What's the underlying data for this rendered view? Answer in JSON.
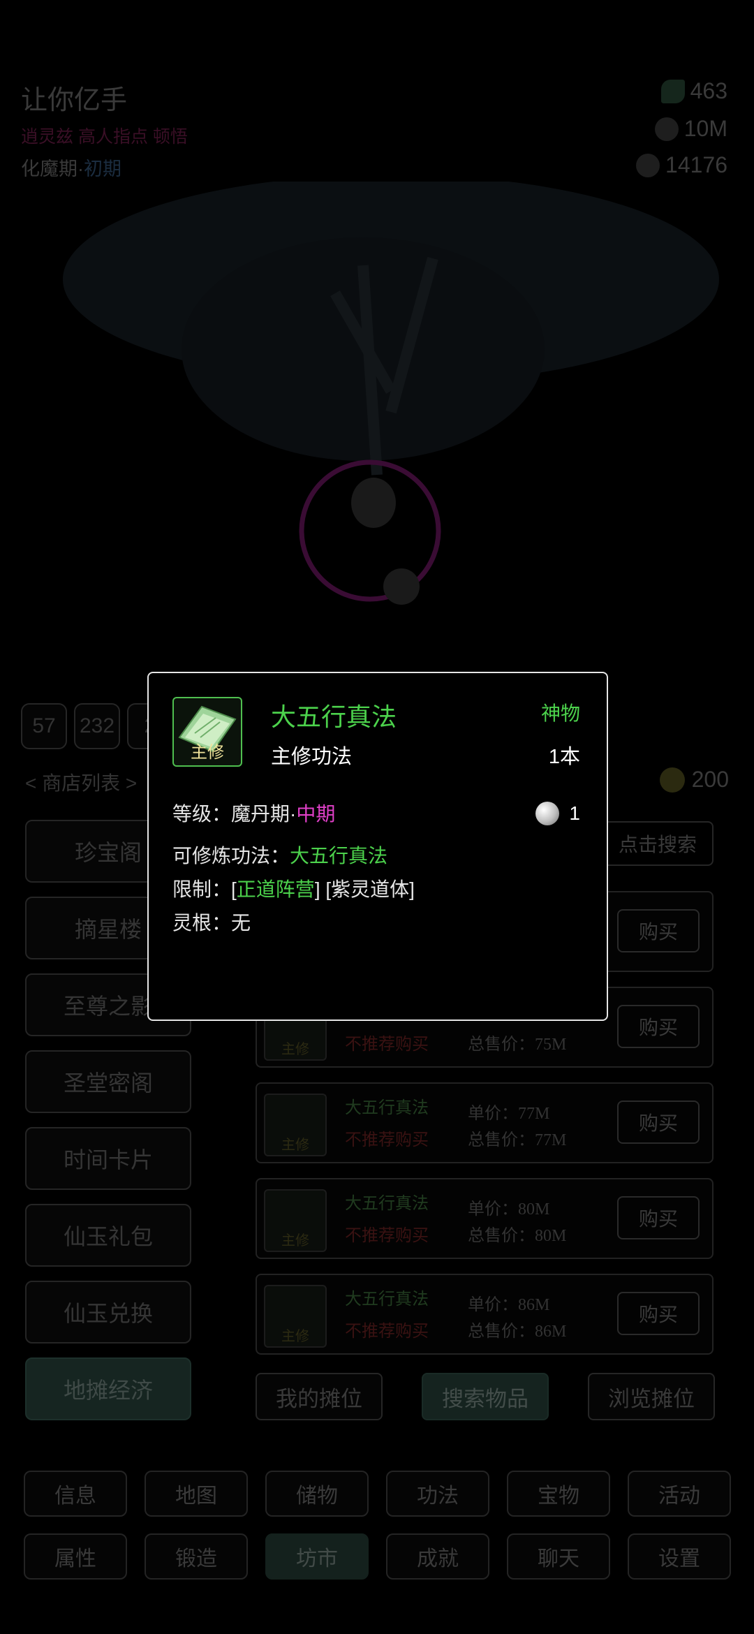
{
  "player": {
    "name": "让你亿手",
    "titles": "逍灵兹 高人指点 顿悟",
    "realm": "化魔期",
    "realm_sep": "·",
    "stage": "初期"
  },
  "resources": [
    {
      "icon": "leaf-icon",
      "value": "463"
    },
    {
      "icon": "silver-coin-icon",
      "value": "10M"
    },
    {
      "icon": "spirit-stone-icon",
      "value": "14176"
    }
  ],
  "badges": [
    "57",
    "232",
    "2"
  ],
  "shop": {
    "list_label": "< 商店列表 >",
    "coin_value": "200",
    "search_click": "点击搜索"
  },
  "side_menu": [
    "珍宝阁",
    "摘星楼",
    "至尊之影",
    "圣堂密阁",
    "时间卡片",
    "仙玉礼包",
    "仙玉兑换",
    "地摊经济"
  ],
  "side_menu_active": 7,
  "listings": [
    {
      "name": "",
      "warn": "",
      "unit": "",
      "total": "",
      "buy": "购买"
    },
    {
      "name": "",
      "warn": "不推荐购买",
      "unit": "",
      "total": "总售价：75M",
      "buy": "购买"
    },
    {
      "name": "大五行真法",
      "warn": "不推荐购买",
      "unit": "单价：77M",
      "total": "总售价：77M",
      "buy": "购买"
    },
    {
      "name": "大五行真法",
      "warn": "不推荐购买",
      "unit": "单价：80M",
      "total": "总售价：80M",
      "buy": "购买"
    },
    {
      "name": "大五行真法",
      "warn": "不推荐购买",
      "unit": "单价：86M",
      "total": "总售价：86M",
      "buy": "购买"
    }
  ],
  "listing_tag": "主修",
  "market_actions": [
    "我的摊位",
    "搜索物品",
    "浏览摊位"
  ],
  "market_active": 1,
  "nav_row1": [
    "信息",
    "地图",
    "储物",
    "功法",
    "宝物",
    "活动"
  ],
  "nav_row2": [
    "属性",
    "锻造",
    "坊市",
    "成就",
    "聊天",
    "设置"
  ],
  "nav_active": "坊市",
  "popup": {
    "icon_tag": "主修",
    "title": "大五行真法",
    "type": "主修功法",
    "rarity": "神物",
    "count": "1本",
    "level_label": "等级：",
    "level_realm": "魔丹期",
    "level_sep": "·",
    "level_stage": "中期",
    "qty": "1",
    "cultivate_label": "可修炼功法：",
    "cultivate_value": "大五行真法",
    "restrict_label": "限制：",
    "restrict_1_open": "[",
    "restrict_1": "正道阵营",
    "restrict_1_close": "]",
    "restrict_2": "[紫灵道体]",
    "root_label": "灵根：",
    "root_value": "无"
  },
  "colors": {
    "accent_green": "#4cd24c",
    "accent_magenta": "#e040c8",
    "popup_border": "#e6e6e6"
  }
}
